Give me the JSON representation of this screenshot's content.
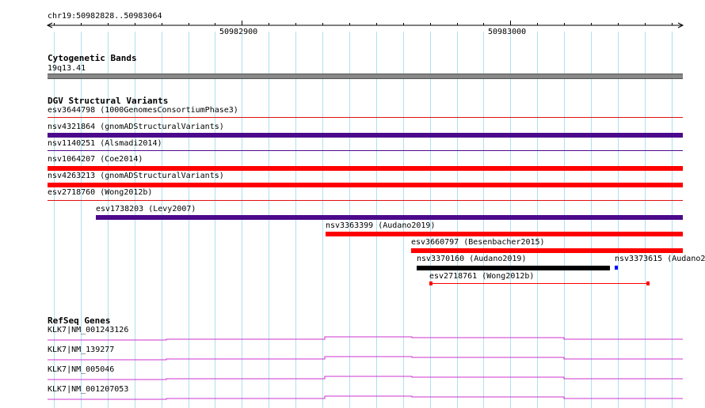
{
  "ruler": {
    "range_label": "chr19:50982828..50983064",
    "tick_label_1": "50982900",
    "tick_label_2": "50983000"
  },
  "tracks": {
    "cytoband": {
      "title": "Cytogenetic Bands",
      "band_label": "19q13.41"
    },
    "dgv": {
      "title": "DGV Structural Variants",
      "variants": [
        {
          "label": "esv3644798 (1000GenomesConsortiumPhase3)",
          "color": "#e01010"
        },
        {
          "label": "nsv4321864 (gnomADStructuralVariants)",
          "color": "#4b0a8c"
        },
        {
          "label": "nsv1140251 (Alsmadi2014)",
          "color": "#4b0a8c"
        },
        {
          "label": "nsv1064207 (Coe2014)",
          "color": "#ff0000"
        },
        {
          "label": "nsv4263213 (gnomADStructuralVariants)",
          "color": "#ff0000"
        },
        {
          "label": "esv2718760 (Wong2012b)",
          "color": "#e01010"
        },
        {
          "label": "esv1738203 (Levy2007)",
          "color": "#4b0a8c"
        },
        {
          "label": "nsv3363399 (Audano2019)",
          "color": "#ff0000"
        },
        {
          "label": "esv3660797 (Besenbacher2015)",
          "color": "#ff0000"
        },
        {
          "label": "nsv3370160 (Audano2019)",
          "color": "#000000"
        },
        {
          "label": "nsv3373615 (Audano2",
          "color": "#0000ff"
        },
        {
          "label": "esv2718761 (Wong2012b)",
          "color": "#ff0000"
        }
      ]
    },
    "refseq": {
      "title": "RefSeq Genes",
      "genes": [
        {
          "label": "KLK7|NM_001243126",
          "color": "#cc33cc"
        },
        {
          "label": "KLK7|NM_139277",
          "color": "#cc33cc"
        },
        {
          "label": "KLK7|NM_005046",
          "color": "#cc33cc"
        },
        {
          "label": "KLK7|NM_001207053",
          "color": "#cc33cc"
        }
      ]
    }
  }
}
